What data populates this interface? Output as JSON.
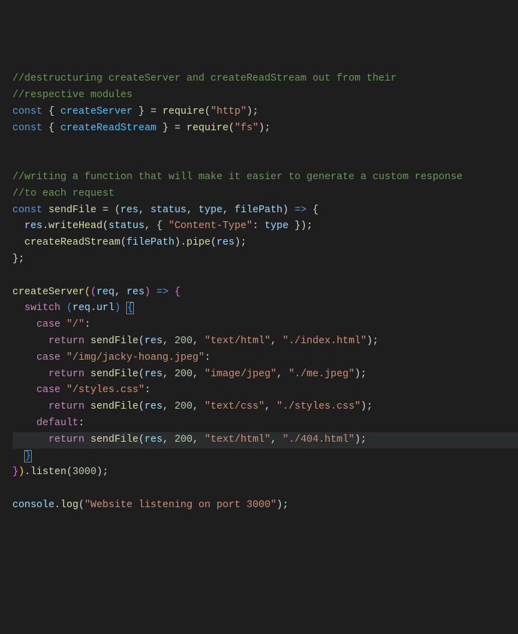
{
  "code": {
    "c1": "//destructuring createServer and createReadStream out from their",
    "c2": "//respective modules",
    "l3": {
      "const": "const",
      "open": " { ",
      "v1": "createServer",
      "close": " } ",
      "eq": "= ",
      "fn": "require",
      "p1": "(",
      "s1": "\"http\"",
      "p2": ")",
      "semi": ";"
    },
    "l4": {
      "const": "const",
      "open": " { ",
      "v1": "createReadStream",
      "close": " } ",
      "eq": "= ",
      "fn": "require",
      "p1": "(",
      "s1": "\"fs\"",
      "p2": ")",
      "semi": ";"
    },
    "c3": "//writing a function that will make it easier to generate a custom response",
    "c4": "//to each request",
    "l9": {
      "const": "const",
      "sp1": " ",
      "fn": "sendFile",
      "sp2": " ",
      "eq": "=",
      "sp3": " ",
      "p1": "(",
      "a1": "res",
      "cm1": ", ",
      "a2": "status",
      "cm2": ", ",
      "a3": "type",
      "cm3": ", ",
      "a4": "filePath",
      "p2": ")",
      "sp4": " ",
      "arrow": "=>",
      "sp5": " ",
      "brace": "{"
    },
    "l10": {
      "indent": "  ",
      "v1": "res",
      "dot1": ".",
      "fn1": "writeHead",
      "p1": "(",
      "a1": "status",
      "cm1": ", ",
      "br1": "{ ",
      "s1": "\"Content-Type\"",
      "colon": ":",
      "sp": " ",
      "a2": "type",
      "br2": " }",
      "p2": ")",
      "semi": ";"
    },
    "l11": {
      "indent": "  ",
      "fn1": "createReadStream",
      "p1": "(",
      "a1": "filePath",
      "p2": ")",
      "dot": ".",
      "fn2": "pipe",
      "p3": "(",
      "a2": "res",
      "p4": ")",
      "semi": ";"
    },
    "l12": {
      "brace": "}",
      "semi": ";"
    },
    "l14": {
      "fn": "createServer",
      "p1": "(",
      "p2": "(",
      "a1": "req",
      "cm": ", ",
      "a2": "res",
      "p3": ")",
      "sp": " ",
      "arrow": "=>",
      "sp2": " ",
      "brace": "{"
    },
    "l15": {
      "indent": "  ",
      "kw": "switch",
      "sp": " ",
      "p1": "(",
      "v1": "req",
      "dot": ".",
      "v2": "url",
      "p2": ")",
      "sp2": " ",
      "brace": "{"
    },
    "l16": {
      "indent": "    ",
      "kw": "case",
      "sp": " ",
      "s": "\"/\"",
      "colon": ":"
    },
    "l17": {
      "indent": "      ",
      "kw": "return",
      "sp": " ",
      "fn": "sendFile",
      "p1": "(",
      "a1": "res",
      "cm1": ", ",
      "n1": "200",
      "cm2": ", ",
      "s1": "\"text/html\"",
      "cm3": ", ",
      "s2": "\"./index.html\"",
      "p2": ")",
      "semi": ";"
    },
    "l18": {
      "indent": "    ",
      "kw": "case",
      "sp": " ",
      "s": "\"/img/jacky-hoang.jpeg\"",
      "colon": ":"
    },
    "l19": {
      "indent": "      ",
      "kw": "return",
      "sp": " ",
      "fn": "sendFile",
      "p1": "(",
      "a1": "res",
      "cm1": ", ",
      "n1": "200",
      "cm2": ", ",
      "s1": "\"image/jpeg\"",
      "cm3": ", ",
      "s2": "\"./me.jpeg\"",
      "p2": ")",
      "semi": ";"
    },
    "l20": {
      "indent": "    ",
      "kw": "case",
      "sp": " ",
      "s": "\"/styles.css\"",
      "colon": ":"
    },
    "l21": {
      "indent": "      ",
      "kw": "return",
      "sp": " ",
      "fn": "sendFile",
      "p1": "(",
      "a1": "res",
      "cm1": ", ",
      "n1": "200",
      "cm2": ", ",
      "s1": "\"text/css\"",
      "cm3": ", ",
      "s2": "\"./styles.css\"",
      "p2": ")",
      "semi": ";"
    },
    "l22": {
      "indent": "    ",
      "kw": "default",
      "colon": ":"
    },
    "l23": {
      "indent": "      ",
      "kw": "return",
      "sp": " ",
      "fn": "sendFile",
      "p1": "(",
      "a1": "res",
      "cm1": ", ",
      "n1": "200",
      "cm2": ", ",
      "s1": "\"text/html\"",
      "cm3": ", ",
      "s2": "\"./404.html\"",
      "p2": ")",
      "semi": ";"
    },
    "l24": {
      "indent": "  ",
      "brace": "}"
    },
    "l25": {
      "brace": "}",
      "p1": ")",
      "dot": ".",
      "fn": "listen",
      "p2": "(",
      "n": "3000",
      "p3": ")",
      "semi": ";"
    },
    "l27": {
      "v": "console",
      "dot": ".",
      "fn": "log",
      "p1": "(",
      "s": "\"Website listening on port 3000\"",
      "p2": ")",
      "semi": ";"
    }
  }
}
